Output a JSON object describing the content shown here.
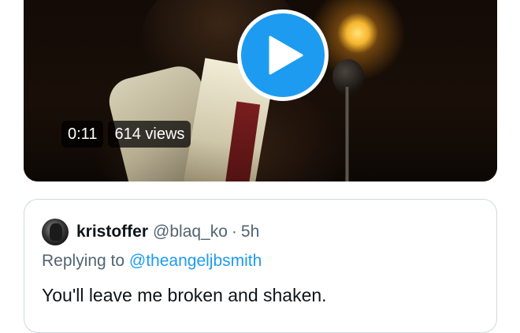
{
  "video": {
    "duration": "0:11",
    "views": "614 views"
  },
  "quote_tweet": {
    "display_name": "kristoffer",
    "handle": "@blaq_ko",
    "separator": "·",
    "time": "5h",
    "replying_prefix": "Replying to",
    "replying_handle": "@theangeljbsmith",
    "text": "You'll leave me broken and shaken."
  },
  "colors": {
    "accent": "#1d9bf0",
    "secondary_text": "#536471",
    "primary_text": "#0f1419",
    "border": "#cfd9de"
  },
  "icons": {
    "play": "play-icon"
  }
}
